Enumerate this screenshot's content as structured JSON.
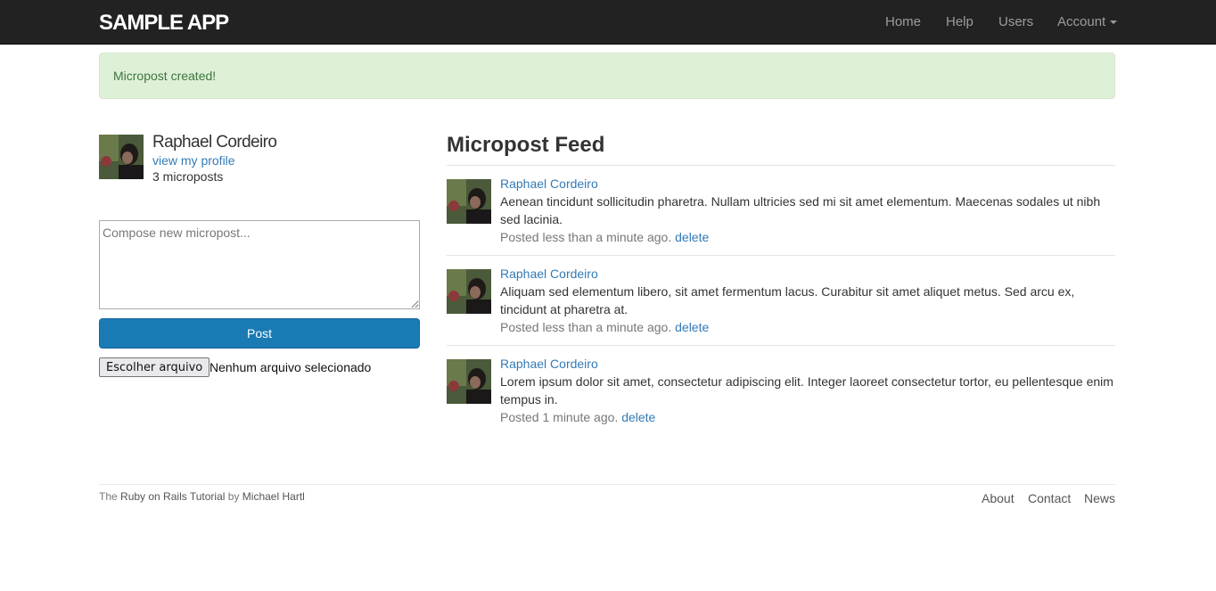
{
  "navbar": {
    "brand": "SAMPLE APP",
    "items": [
      {
        "label": "Home"
      },
      {
        "label": "Help"
      },
      {
        "label": "Users"
      },
      {
        "label": "Account"
      }
    ]
  },
  "alert": {
    "message": "Micropost created!"
  },
  "sidebar": {
    "user_name": "Raphael Cordeiro",
    "profile_link": "view my profile",
    "post_count": "3 microposts",
    "compose_placeholder": "Compose new micropost...",
    "post_button": "Post",
    "file_button": "Escolher arquivo",
    "file_status": "Nenhum arquivo selecionado"
  },
  "feed": {
    "title": "Micropost Feed",
    "posts": [
      {
        "user": "Raphael Cordeiro",
        "content": "Aenean tincidunt sollicitudin pharetra. Nullam ultricies sed mi sit amet elementum. Maecenas sodales ut nibh sed lacinia.",
        "timestamp": "Posted less than a minute ago.",
        "delete_label": "delete"
      },
      {
        "user": "Raphael Cordeiro",
        "content": "Aliquam sed elementum libero, sit amet fermentum lacus. Curabitur sit amet aliquet metus. Sed arcu ex, tincidunt at pharetra at.",
        "timestamp": "Posted less than a minute ago.",
        "delete_label": "delete"
      },
      {
        "user": "Raphael Cordeiro",
        "content": "Lorem ipsum dolor sit amet, consectetur adipiscing elit. Integer laoreet consectetur tortor, eu pellentesque enim tempus in.",
        "timestamp": "Posted 1 minute ago.",
        "delete_label": "delete"
      }
    ]
  },
  "footer": {
    "prefix": "The",
    "tutorial_link": "Ruby on Rails Tutorial",
    "by": "by",
    "author_link": "Michael Hartl",
    "links": [
      {
        "label": "About"
      },
      {
        "label": "Contact"
      },
      {
        "label": "News"
      }
    ]
  },
  "colors": {
    "navbar_bg": "#222222",
    "link": "#337ab7",
    "primary_button": "#1a7ab3",
    "alert_bg": "#dff0d8",
    "alert_text": "#3c763d"
  }
}
